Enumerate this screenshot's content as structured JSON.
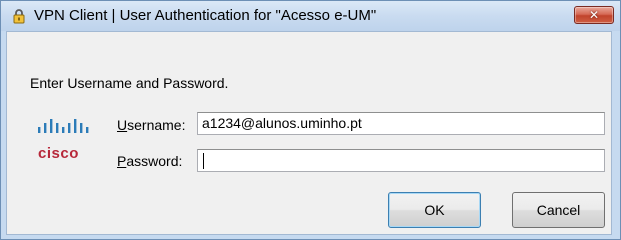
{
  "window": {
    "title": "VPN Client  |  User Authentication for \"Acesso e-UM\"",
    "close_glyph": "✕",
    "title_icon": "padlock-icon"
  },
  "dialog": {
    "prompt": "Enter Username and Password.",
    "logo": {
      "icon": "cisco-logo",
      "wordmark": "cisco"
    },
    "username": {
      "label_accel": "U",
      "label_rest": "sername:",
      "value": "a1234@alunos.uminho.pt"
    },
    "password": {
      "label_accel": "P",
      "label_rest": "assword:",
      "value": ""
    },
    "buttons": {
      "ok": "OK",
      "cancel": "Cancel"
    }
  },
  "colors": {
    "cisco_red": "#b7283a",
    "cisco_blue": "#2c7cb8",
    "close_red": "#c1432c",
    "frame_blue": "#c6daf0"
  }
}
